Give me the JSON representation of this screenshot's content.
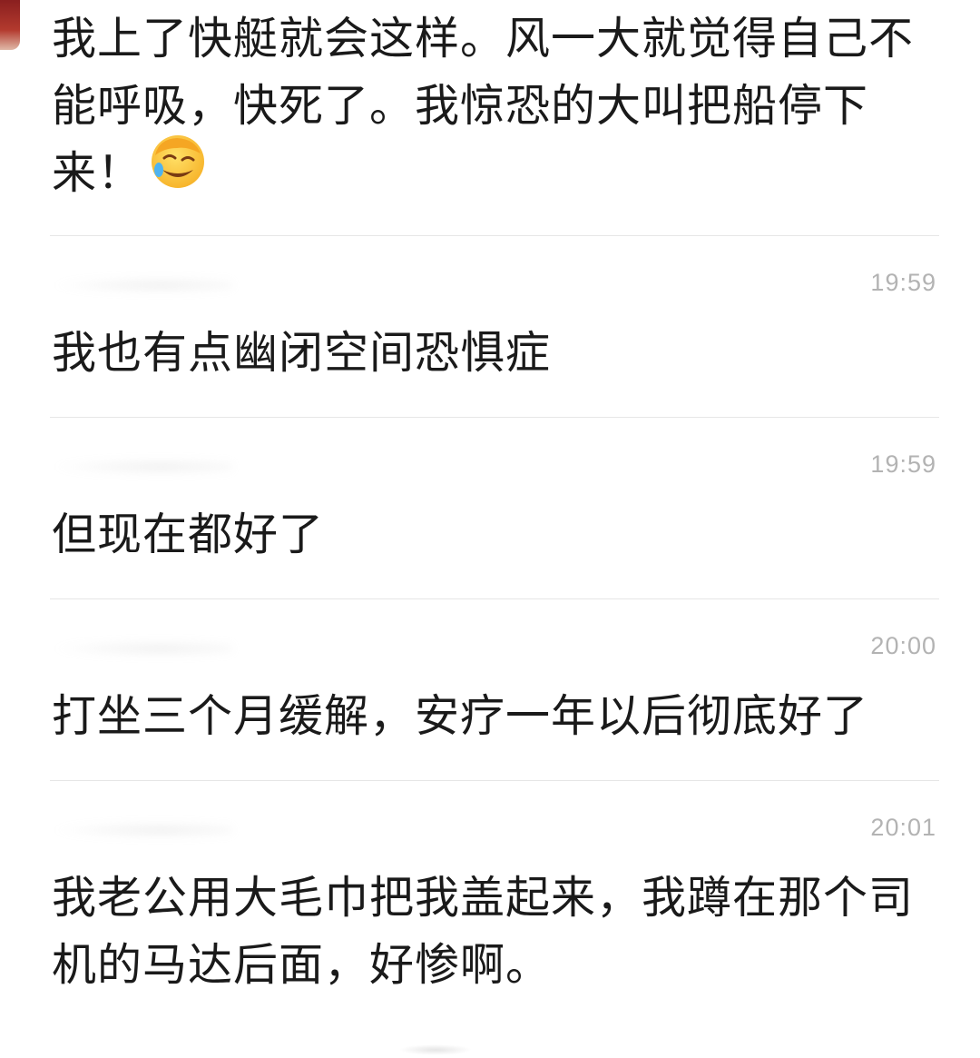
{
  "comments": [
    {
      "text": "我上了快艇就会这样。风一大就觉得自己不能呼吸，快死了。我惊恐的大叫把船停下来！",
      "emoji": "facepalm-laugh-emoji"
    },
    {
      "time": "19:59",
      "text": "我也有点幽闭空间恐惧症"
    },
    {
      "time": "19:59",
      "text": "但现在都好了"
    },
    {
      "time": "20:00",
      "text": "打坐三个月缓解，安疗一年以后彻底好了"
    },
    {
      "time": "20:01",
      "text": "我老公用大毛巾把我盖起来，我蹲在那个司机的马达后面，好惨啊。"
    }
  ]
}
